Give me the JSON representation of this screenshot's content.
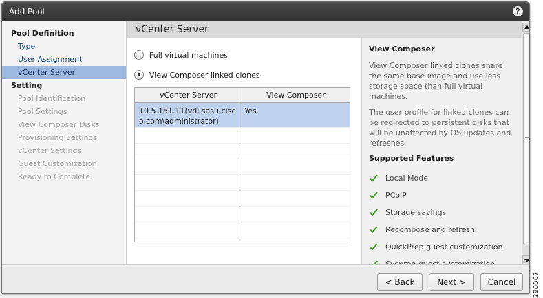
{
  "dialog": {
    "title": "Add Pool",
    "help_label": "?"
  },
  "nav": {
    "pool_definition_heading": "Pool Definition",
    "pool_definition_items": [
      {
        "label": "Type",
        "state": "link"
      },
      {
        "label": "User Assignment",
        "state": "link"
      },
      {
        "label": "vCenter Server",
        "state": "active"
      }
    ],
    "setting_heading": "Setting",
    "setting_items": [
      {
        "label": "Pool Identification",
        "state": "disabled"
      },
      {
        "label": "Pool Settings",
        "state": "disabled"
      },
      {
        "label": "View Composer Disks",
        "state": "disabled"
      },
      {
        "label": "Provisioning Settings",
        "state": "disabled"
      },
      {
        "label": "vCenter Settings",
        "state": "disabled"
      },
      {
        "label": "Guest Customization",
        "state": "disabled"
      },
      {
        "label": "Ready to Complete",
        "state": "disabled"
      }
    ]
  },
  "main": {
    "header": "vCenter Server",
    "options": [
      {
        "label": "Full virtual machines",
        "checked": false
      },
      {
        "label": "View Composer linked clones",
        "checked": true
      }
    ],
    "table": {
      "columns": [
        "vCenter Server",
        "View Composer"
      ],
      "rows": [
        {
          "server": "10.5.151.11(vdi.sasu.cisc\no.com\\administrator)",
          "composer": "Yes",
          "selected": true
        }
      ],
      "empty_rows": 8
    }
  },
  "info": {
    "title": "View Composer",
    "paragraphs": [
      "View Composer linked clones share the same base image and use less storage space than full virtual machines.",
      "The user profile for linked clones can be redirected to persistent disks that will be unaffected by OS updates and refreshes."
    ],
    "features_heading": "Supported Features",
    "features": [
      "Local Mode",
      "PCoIP",
      "Storage savings",
      "Recompose and refresh",
      "QuickPrep guest customization",
      "Sysprep guest customization"
    ],
    "check_color": "#4aa02c"
  },
  "footer": {
    "back_label": "< Back",
    "next_label": "Next >",
    "cancel_label": "Cancel"
  },
  "figure_id": "290067"
}
